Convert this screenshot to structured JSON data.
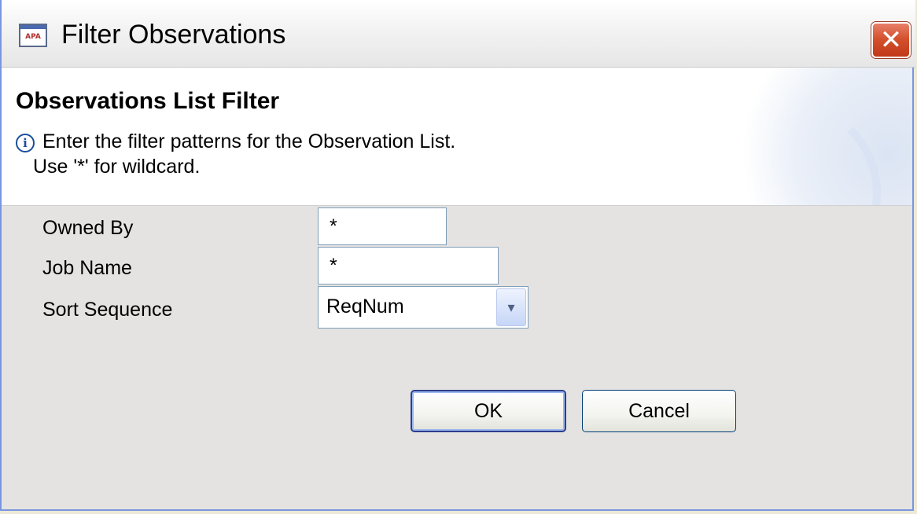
{
  "window": {
    "title": "Filter Observations",
    "app_icon_text": "APA",
    "close_glyph": "✕"
  },
  "header": {
    "title": "Observations List Filter",
    "info_icon": "i",
    "message_line1": "Enter the filter patterns for the Observation List.",
    "message_line2": "Use '*' for wildcard."
  },
  "form": {
    "owned_by": {
      "label": "Owned By",
      "value": "*"
    },
    "job_name": {
      "label": "Job Name",
      "value": "*"
    },
    "sort_sequence": {
      "label": "Sort Sequence",
      "value": "ReqNum",
      "arrow": "▾"
    }
  },
  "buttons": {
    "ok": "OK",
    "cancel": "Cancel"
  }
}
